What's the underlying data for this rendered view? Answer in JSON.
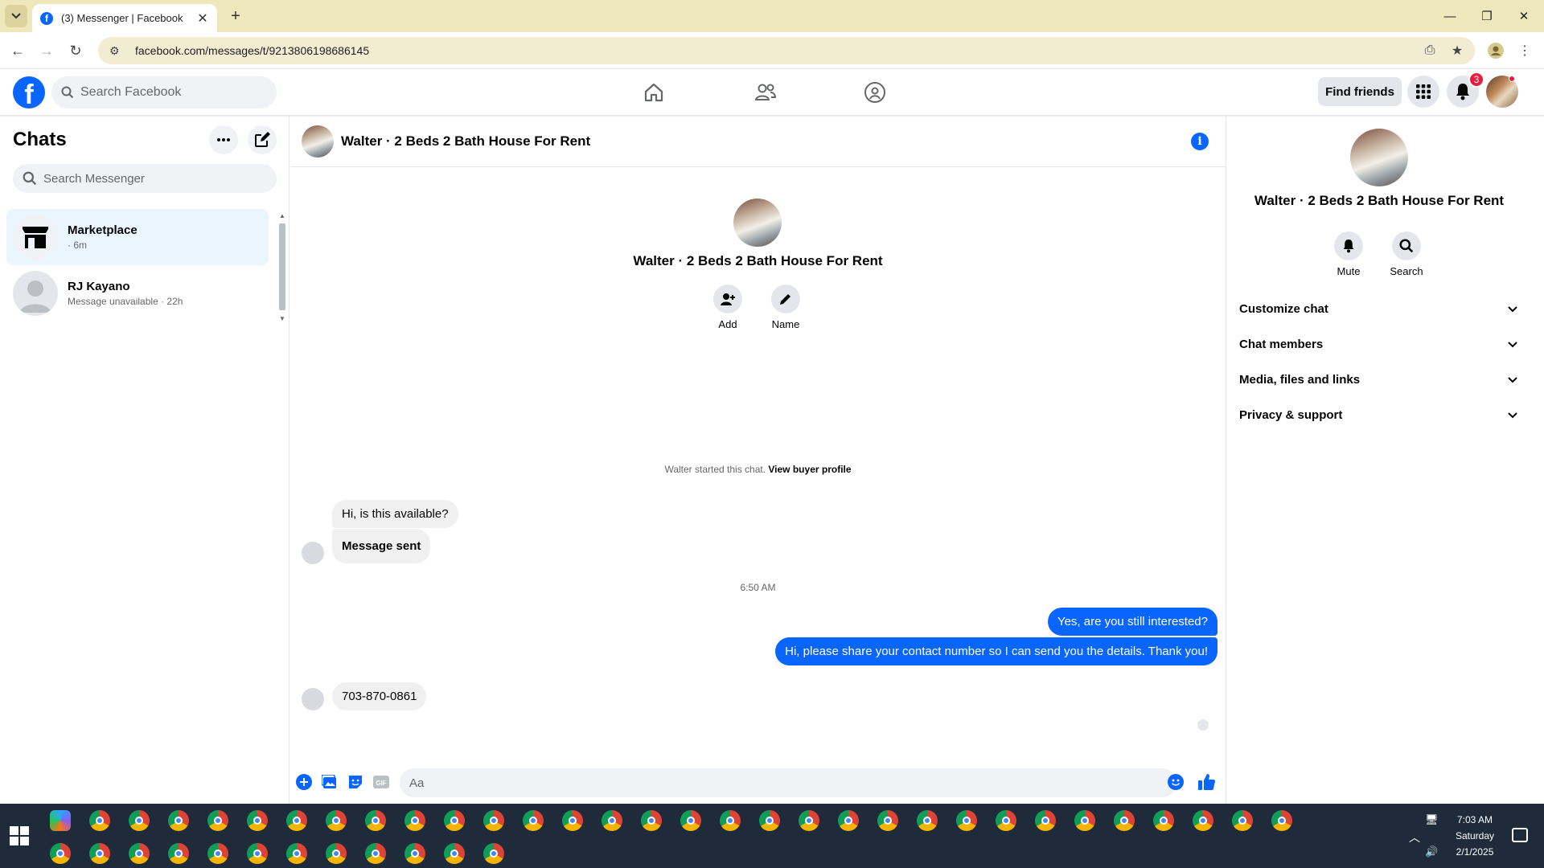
{
  "browser": {
    "tab_title": "(3) Messenger | Facebook",
    "url": "facebook.com/messages/t/9213806198686145"
  },
  "fb_header": {
    "search_placeholder": "Search Facebook",
    "find_friends": "Find friends",
    "notification_count": "3"
  },
  "sidebar": {
    "title": "Chats",
    "search_placeholder": "Search Messenger",
    "chats": [
      {
        "name": "Marketplace",
        "sub": "· 6m"
      },
      {
        "name": "RJ Kayano",
        "sub": "Message unavailable · 22h"
      }
    ]
  },
  "conversation": {
    "title": "Walter · 2 Beds 2 Bath House For Rent",
    "actions": {
      "add": "Add",
      "name": "Name"
    },
    "started_text": "Walter started this chat.",
    "view_buyer_profile": "View buyer profile",
    "messages": {
      "in1": "Hi, is this available?",
      "in2": "Message sent",
      "timestamp": "6:50 AM",
      "out1": "Yes, are you still interested?",
      "out2": "Hi, please share your contact number so I can send you the details. Thank you!",
      "in3": "703-870-0861"
    },
    "composer_placeholder": "Aa"
  },
  "right_panel": {
    "name": "Walter · 2 Beds 2 Bath House For Rent",
    "mute": "Mute",
    "search": "Search",
    "rows": [
      "Customize chat",
      "Chat members",
      "Media, files and links",
      "Privacy & support"
    ]
  },
  "taskbar": {
    "time": "7:03 AM",
    "day": "Saturday",
    "date": "2/1/2025"
  },
  "colors": {
    "accent": "#0866ff",
    "badge": "#e41e3f",
    "tabbar": "#efe7bc"
  }
}
